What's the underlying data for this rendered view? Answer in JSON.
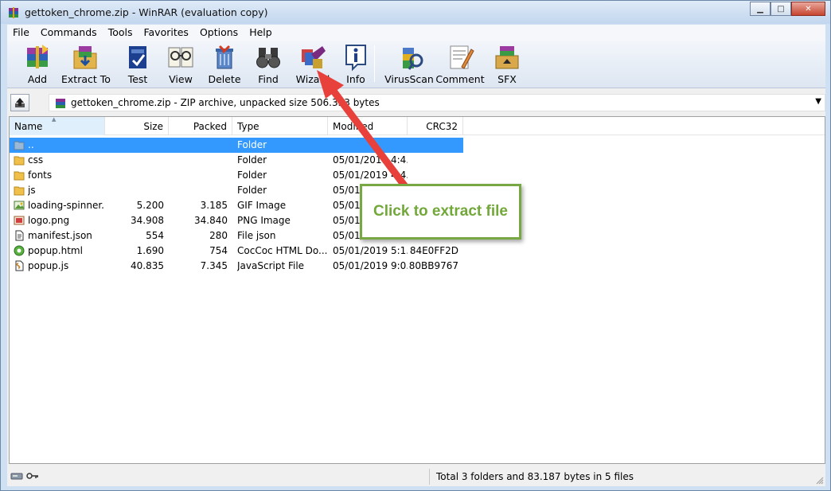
{
  "window": {
    "title": "gettoken_chrome.zip - WinRAR (evaluation copy)",
    "controls": {
      "minimize": "▁",
      "maximize": "□",
      "close": "✕"
    }
  },
  "menu": [
    "File",
    "Commands",
    "Tools",
    "Favorites",
    "Options",
    "Help"
  ],
  "toolbar": [
    {
      "label": "Add",
      "icon": "add-archive-icon"
    },
    {
      "label": "Extract To",
      "icon": "extract-to-icon"
    },
    {
      "label": "Test",
      "icon": "test-icon"
    },
    {
      "label": "View",
      "icon": "view-icon"
    },
    {
      "label": "Delete",
      "icon": "delete-icon"
    },
    {
      "label": "Find",
      "icon": "find-binoculars-icon"
    },
    {
      "label": "Wizard",
      "icon": "wizard-icon"
    },
    {
      "label": "Info",
      "icon": "info-icon"
    },
    {
      "label": "VirusScan",
      "icon": "virusscan-icon"
    },
    {
      "label": "Comment",
      "icon": "comment-icon"
    },
    {
      "label": "SFX",
      "icon": "sfx-icon"
    }
  ],
  "address": {
    "text": "gettoken_chrome.zip - ZIP archive, unpacked size 506.333 bytes",
    "up_icon": "up-folder-icon"
  },
  "columns": [
    "Name",
    "Size",
    "Packed",
    "Type",
    "Modified",
    "CRC32"
  ],
  "files": [
    {
      "name": "..",
      "size": "",
      "packed": "",
      "type": "Folder",
      "modified": "",
      "crc": "",
      "icon": "parent-folder-icon",
      "selected": true
    },
    {
      "name": "css",
      "size": "",
      "packed": "",
      "type": "Folder",
      "modified": "05/01/2019 4:4...",
      "crc": "",
      "icon": "folder-icon"
    },
    {
      "name": "fonts",
      "size": "",
      "packed": "",
      "type": "Folder",
      "modified": "05/01/2019 4:4...",
      "crc": "",
      "icon": "folder-icon"
    },
    {
      "name": "js",
      "size": "",
      "packed": "",
      "type": "Folder",
      "modified": "05/01/2019 4:4...",
      "crc": "",
      "icon": "folder-icon"
    },
    {
      "name": "loading-spinner....",
      "size": "5.200",
      "packed": "3.185",
      "type": "GIF Image",
      "modified": "05/01/2019 4:4...",
      "crc": "",
      "icon": "image-icon"
    },
    {
      "name": "logo.png",
      "size": "34.908",
      "packed": "34.840",
      "type": "PNG Image",
      "modified": "05/01/2019 4:4...",
      "crc": "",
      "icon": "png-icon"
    },
    {
      "name": "manifest.json",
      "size": "554",
      "packed": "280",
      "type": "File json",
      "modified": "05/01/2019 4:4...",
      "crc": "",
      "icon": "file-icon"
    },
    {
      "name": "popup.html",
      "size": "1.690",
      "packed": "754",
      "type": "CocCoc HTML Do...",
      "modified": "05/01/2019 5:1...",
      "crc": "84E0FF2D",
      "icon": "html-file-icon"
    },
    {
      "name": "popup.js",
      "size": "40.835",
      "packed": "7.345",
      "type": "JavaScript File",
      "modified": "05/01/2019 9:0...",
      "crc": "80BB9767",
      "icon": "js-file-icon"
    }
  ],
  "status": {
    "text": "Total 3 folders and 83.187 bytes in 5 files"
  },
  "callout": {
    "text": "Click to extract file",
    "color": "#72a83a",
    "arrow_color": "#e8403a"
  }
}
